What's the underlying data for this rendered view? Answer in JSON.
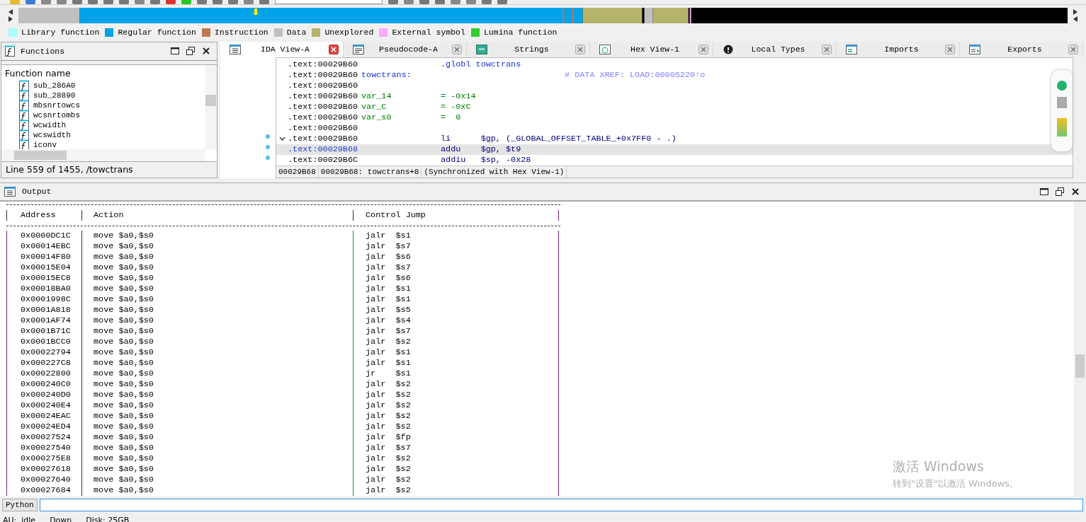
{
  "legend": [
    {
      "label": "Library function",
      "color": "#a8ffff"
    },
    {
      "label": "Regular function",
      "color": "#00a2e8"
    },
    {
      "label": "Instruction",
      "color": "#c07850"
    },
    {
      "label": "Data",
      "color": "#c0c0c0"
    },
    {
      "label": "Unexplored",
      "color": "#b4b46c"
    },
    {
      "label": "External symbol",
      "color": "#ffa8ff"
    },
    {
      "label": "Lumina function",
      "color": "#33cc33"
    }
  ],
  "functions_panel": {
    "title": "Functions",
    "column": "Function name",
    "items": [
      "sub_286A0",
      "sub_28890",
      "mbsnrtowcs",
      "wcsnrtombs",
      "wcwidth",
      "wcswidth",
      "iconv"
    ],
    "status": "Line 559 of 1455, /towctrans"
  },
  "tabs": [
    {
      "label": "IDA View-A",
      "selected": true
    },
    {
      "label": "Pseudocode-A",
      "selected": false
    },
    {
      "label": "Strings",
      "selected": false
    },
    {
      "label": "Hex View-1",
      "selected": false
    },
    {
      "label": "Local Types",
      "selected": false
    },
    {
      "label": "Imports",
      "selected": false
    },
    {
      "label": "Exports",
      "selected": false
    }
  ],
  "disassembly": {
    "lines": [
      {
        "address": ".text:00029B60",
        "kind": "directive",
        "text": ".globl towctrans",
        "selected": false,
        "fold": false
      },
      {
        "address": ".text:00029B60",
        "kind": "name",
        "label": "towctrans:",
        "comment": "# DATA XREF: LOAD:00005220↑o",
        "selected": false,
        "fold": false
      },
      {
        "address": ".text:00029B60",
        "kind": "blank",
        "selected": false,
        "fold": false
      },
      {
        "address": ".text:00029B60",
        "kind": "stackvar",
        "label": "var_14",
        "text": "= -0x14",
        "selected": false,
        "fold": false
      },
      {
        "address": ".text:00029B60",
        "kind": "stackvar",
        "label": "var_C",
        "text": "= -0xC",
        "selected": false,
        "fold": false
      },
      {
        "address": ".text:00029B60",
        "kind": "stackvar",
        "label": "var_s0",
        "text": "=  0",
        "selected": false,
        "fold": false
      },
      {
        "address": ".text:00029B60",
        "kind": "blank",
        "selected": false,
        "fold": false
      },
      {
        "address": ".text:00029B60",
        "kind": "code",
        "text": "li      $gp, (_GLOBAL_OFFSET_TABLE_+0x7FF0 - .)",
        "selected": false,
        "fold": true
      },
      {
        "address": ".text:00029B68",
        "kind": "code",
        "text": "addu    $gp, $t9",
        "selected": true,
        "fold": false
      },
      {
        "address": ".text:00029B6C",
        "kind": "code",
        "text": "addiu   $sp, -0x28",
        "selected": false,
        "fold": false
      }
    ],
    "status": [
      "00029B68",
      "00029B68: towctrans+8",
      "(Synchronized with Hex View-1)"
    ]
  },
  "output": {
    "title": "Output",
    "columns": [
      "Address",
      "Action",
      "Control Jump"
    ],
    "rows": [
      [
        "0x0000DC1C",
        "move $a0,$s0",
        "jalr  $s1"
      ],
      [
        "0x00014EBC",
        "move $a0,$s0",
        "jalr  $s7"
      ],
      [
        "0x00014F80",
        "move $a0,$s0",
        "jalr  $s6"
      ],
      [
        "0x00015E04",
        "move $a0,$s0",
        "jalr  $s7"
      ],
      [
        "0x00015EC8",
        "move $a0,$s0",
        "jalr  $s6"
      ],
      [
        "0x00018BA0",
        "move $a0,$s0",
        "jalr  $s1"
      ],
      [
        "0x0001998C",
        "move $a0,$s0",
        "jalr  $s1"
      ],
      [
        "0x0001A818",
        "move $a0,$s0",
        "jalr  $s5"
      ],
      [
        "0x0001AF74",
        "move $a0,$s0",
        "jalr  $s4"
      ],
      [
        "0x0001B71C",
        "move $a0,$s0",
        "jalr  $s7"
      ],
      [
        "0x0001BCC0",
        "move $a0,$s0",
        "jalr  $s2"
      ],
      [
        "0x00022794",
        "move $a0,$s0",
        "jalr  $s1"
      ],
      [
        "0x000227C8",
        "move $a0,$s0",
        "jalr  $s1"
      ],
      [
        "0x00022800",
        "move $a0,$s0",
        "jr    $s1"
      ],
      [
        "0x000240C0",
        "move $a0,$s0",
        "jalr  $s2"
      ],
      [
        "0x000240D0",
        "move $a0,$s0",
        "jalr  $s2"
      ],
      [
        "0x000240E4",
        "move $a0,$s0",
        "jalr  $s2"
      ],
      [
        "0x00024EAC",
        "move $a0,$s0",
        "jalr  $s2"
      ],
      [
        "0x00024ED4",
        "move $a0,$s0",
        "jalr  $s2"
      ],
      [
        "0x00027524",
        "move $a0,$s0",
        "jalr  $fp"
      ],
      [
        "0x00027540",
        "move $a0,$s0",
        "jalr  $s7"
      ],
      [
        "0x000275E8",
        "move $a0,$s0",
        "jalr  $s2"
      ],
      [
        "0x00027618",
        "move $a0,$s0",
        "jalr  $s2"
      ],
      [
        "0x00027640",
        "move $a0,$s0",
        "jalr  $s2"
      ],
      [
        "0x00027684",
        "move $a0,$s0",
        "jalr  $s2"
      ]
    ]
  },
  "python": {
    "button": "Python"
  },
  "status_bar": [
    "AU:  idle",
    "Down",
    "Disk: 25GB"
  ],
  "activation_notice": {
    "title": "激活 Windows",
    "text": "转到\"设置\"以激活 Windows。"
  }
}
